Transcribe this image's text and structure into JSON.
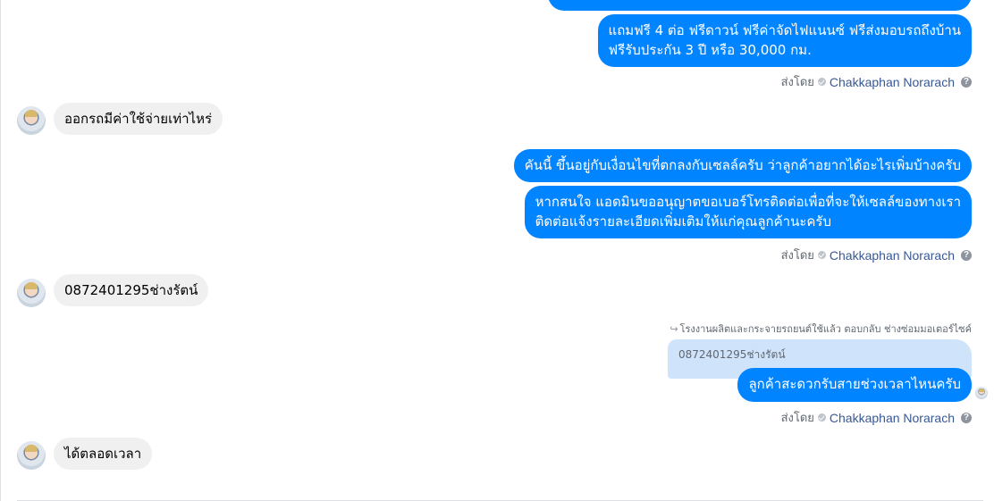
{
  "messages": {
    "top_bubble": {
      "line1": "แถมฟรี 4 ต่อ ฟรีดาวน์ ฟรีค่าจัดไฟแนนซ์ ฟรีส่งมอบรถถึงบ้าน",
      "line2": "ฟรีรับประกัน 3 ปี หรือ 30,000 กม."
    },
    "incoming1": "ออกรถมีค่าใช้จ่ายเท่าไหร่",
    "out2": "คันนี้ ขึ้นอยู่กับเงื่อนไขที่ตกลงกับเซลล์ครับ ว่าลูกค้าอยากได้อะไรเพิ่มบ้างครับ",
    "out3": {
      "line1": "หากสนใจ แอดมินขออนุญาตขอเบอร์โทรติดต่อเพื่อที่จะให้เซลล์ของทางเรา",
      "line2": "ติดต่อแจ้งรายละเอียดเพิ่มเติมให้แก่คุณลูกค้านะครับ"
    },
    "incoming2": "0872401295ช่างรัตน์",
    "reply_label": "โรงงานผลิตและกระจายรถยนต์ใช้แล้ว ตอบกลับ ช่างซ่อมมอเตอร์ไซค์",
    "quoted_text": "0872401295ช่างรัตน์",
    "out4": "ลูกค้าสะดวกรับสายช่วงเวลาไหนครับ",
    "incoming3": "ได้ตลอดเวลา"
  },
  "sent_by": {
    "prefix": "ส่งโดย",
    "name": "Chakkaphan Norarach",
    "help": "?"
  },
  "colors": {
    "outgoing_bubble": "#0084ff",
    "incoming_bubble": "#f1f0f0",
    "quoted_bubble": "#cfe3fb",
    "sender_name": "#385898"
  },
  "icons": {
    "sent_check": "check-circle-icon",
    "help": "question-circle-icon",
    "reply": "reply-arrow-icon"
  }
}
